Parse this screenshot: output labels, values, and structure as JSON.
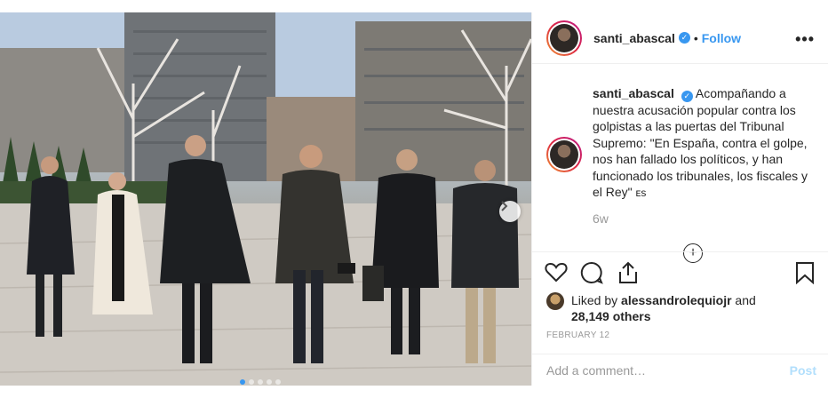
{
  "post": {
    "username": "santi_abascal",
    "follow_label": "Follow",
    "separator": "•",
    "more_label": "•••",
    "caption": "Acompañando a nuestra acusación popular contra los golpistas a las puertas del Tribunal Supremo: \"En España, contra el golpe, nos han fallado los políticos, y han funcionado los tribunales, los fiscales y el Rey\"",
    "caption_flag": "ᴇs",
    "time_ago": "6w",
    "load_more_label": "+",
    "likes_prefix": "Liked by",
    "likes_user": "alessandrolequiojr",
    "likes_and": "and",
    "likes_count": "28,149 others",
    "date": "FEBRUARY 12",
    "comment_placeholder": "Add a comment…",
    "post_label": "Post"
  },
  "carousel": {
    "dot_count": 5,
    "active_dot": 1
  },
  "icons": {
    "verified": "verified-badge-icon",
    "like": "heart-icon",
    "comment": "comment-bubble-icon",
    "share": "share-icon",
    "save": "bookmark-icon",
    "next": "chevron-right-icon"
  },
  "colors": {
    "accent": "#3897f0",
    "post_disabled": "#b2dffc",
    "muted": "#999999",
    "text": "#262626"
  }
}
